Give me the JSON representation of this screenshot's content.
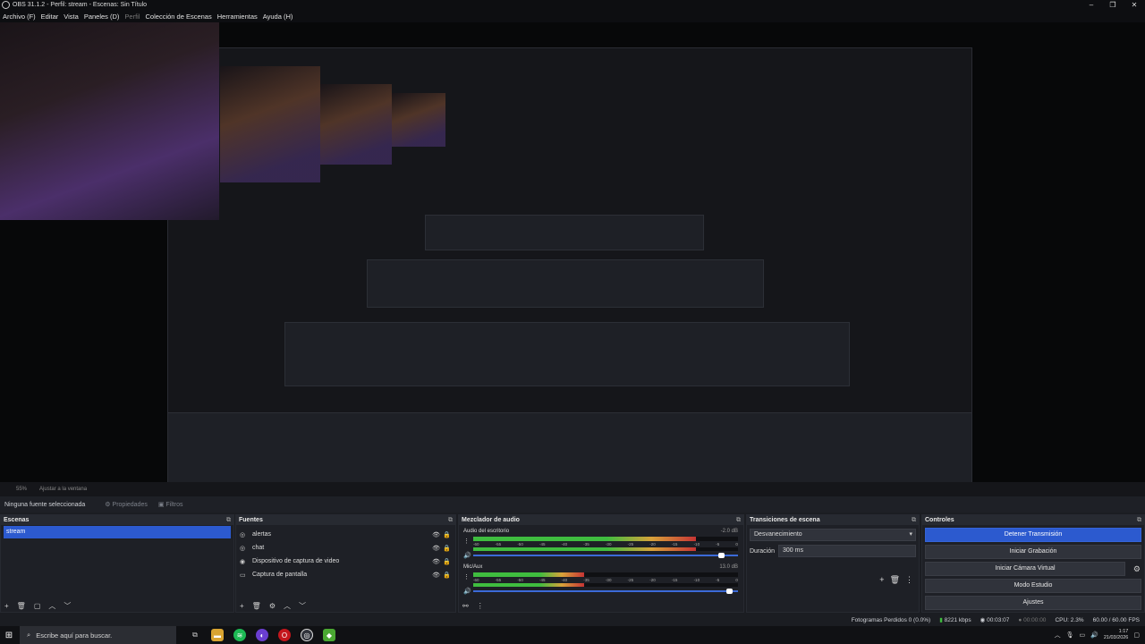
{
  "window": {
    "title": "OBS 31.1.2 - Perfil: stream - Escenas: Sin Título",
    "controls": [
      "–",
      "❐",
      "✕"
    ]
  },
  "menu": [
    "Archivo (F)",
    "Editar",
    "Vista",
    "Paneles (D)",
    "Perfil",
    "Colección de Escenas",
    "Herramientas",
    "Ayuda (H)"
  ],
  "preview": {
    "zoom": "55%",
    "fit_label": "Ajustar a la ventana"
  },
  "selection_bar": {
    "none_selected": "Ninguna fuente seleccionada",
    "properties": "Propiedades",
    "filters": "Filtros"
  },
  "scenes": {
    "title": "Escenas",
    "items": [
      "stream"
    ]
  },
  "sources": {
    "title": "Fuentes",
    "items": [
      "alertas",
      "chat",
      "Dispositivo de captura de video",
      "Captura de pantalla"
    ]
  },
  "mixer": {
    "title": "Mezclador de audio",
    "ticks": [
      "-60",
      "-55",
      "-50",
      "-45",
      "-40",
      "-35",
      "-30",
      "-25",
      "-20",
      "-15",
      "-10",
      "-5",
      "0"
    ],
    "channels": [
      {
        "name": "Audio del escritorio",
        "db": "-2.0 dB",
        "level": 0.84,
        "volume": 0.95
      },
      {
        "name": "Mic/Aux",
        "db": "13.0 dB",
        "level": 0.42,
        "volume": 0.98
      }
    ]
  },
  "transitions": {
    "title": "Transiciones de escena",
    "selected": "Desvanecimiento",
    "duration_label": "Duración",
    "duration_value": "300 ms"
  },
  "controls": {
    "title": "Controles",
    "buttons": [
      "Detener Transmisión",
      "Iniciar Grabación",
      "Iniciar Cámara Virtual",
      "Modo Estudio",
      "Ajustes"
    ]
  },
  "status": {
    "dropped": "Fotogramas Perdidos 0 (0.0%)",
    "bitrate": "8221 kbps",
    "stream_time": "00:03:07",
    "rec_time": "00:00:00",
    "cpu": "CPU: 2.3%",
    "fps": "60.00 / 60.00 FPS"
  },
  "taskbar": {
    "search_placeholder": "Escribe aquí para buscar.",
    "time": "1:17",
    "date": "21/03/2026"
  },
  "colors": {
    "accent": "#2c5acf",
    "meter_green": "#3fbd3f",
    "meter_yellow": "#d8a23a",
    "meter_red": "#c63434"
  }
}
